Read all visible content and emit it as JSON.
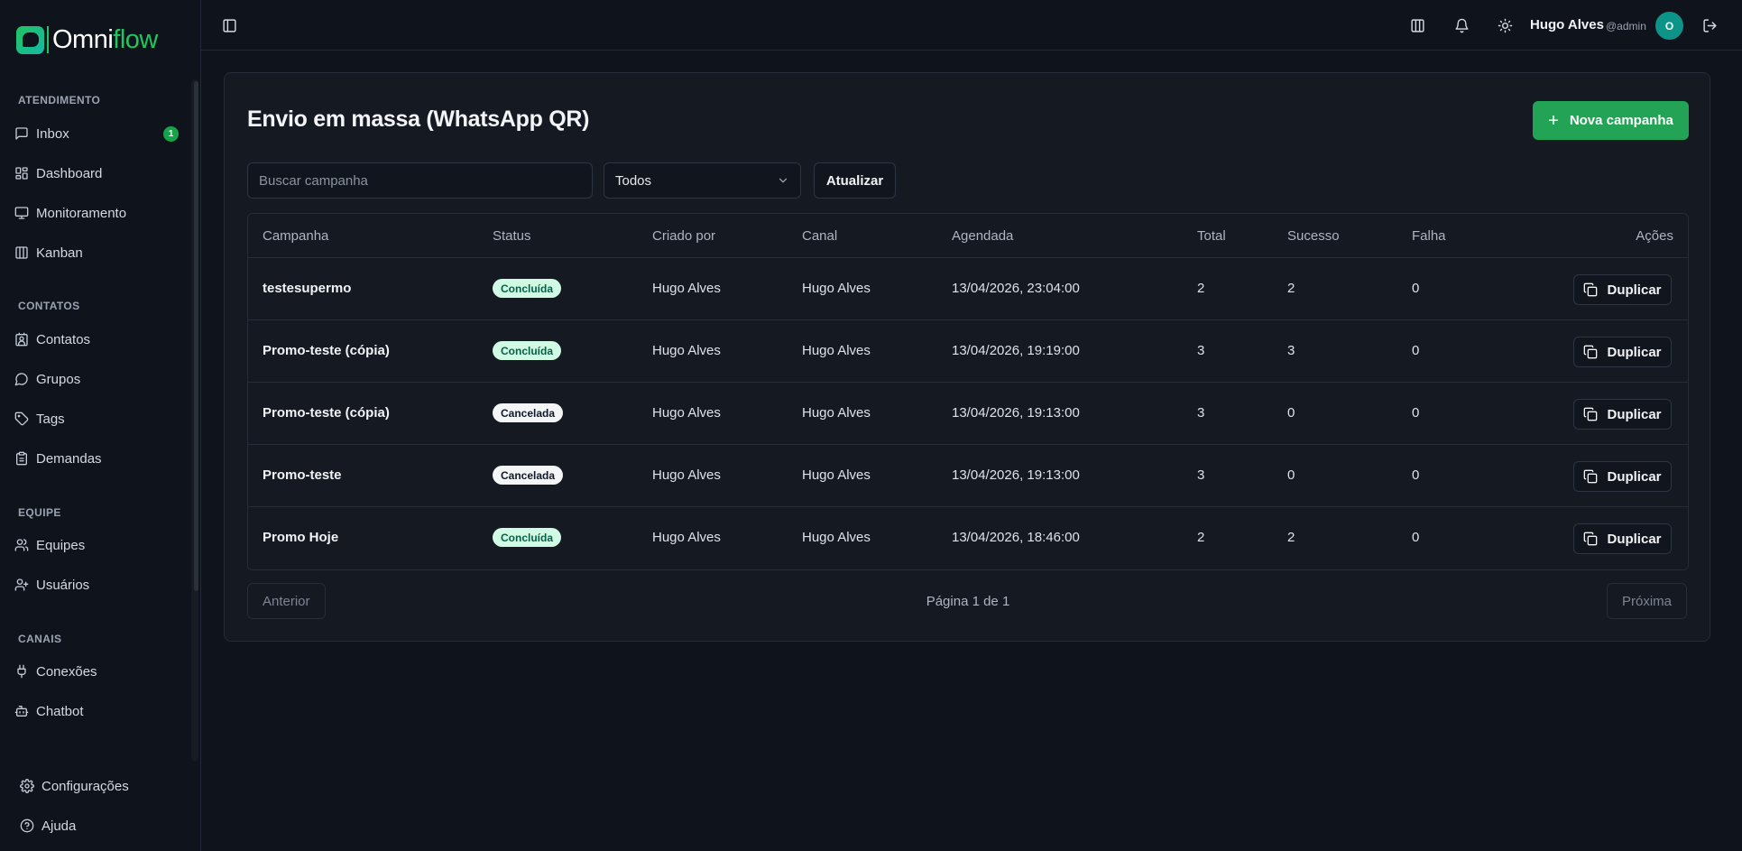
{
  "brand": {
    "name_part1": "Omni",
    "name_part2": "flow"
  },
  "sidebar": {
    "sections": [
      {
        "title": "ATENDIMENTO",
        "items": [
          {
            "label": "Inbox",
            "icon": "message-square-icon",
            "badge": "1"
          },
          {
            "label": "Dashboard",
            "icon": "layout-dashboard-icon"
          },
          {
            "label": "Monitoramento",
            "icon": "monitor-icon"
          },
          {
            "label": "Kanban",
            "icon": "kanban-icon"
          }
        ]
      },
      {
        "title": "CONTATOS",
        "items": [
          {
            "label": "Contatos",
            "icon": "contact-icon"
          },
          {
            "label": "Grupos",
            "icon": "message-circle-icon"
          },
          {
            "label": "Tags",
            "icon": "tag-icon"
          },
          {
            "label": "Demandas",
            "icon": "clipboard-icon"
          }
        ]
      },
      {
        "title": "EQUIPE",
        "items": [
          {
            "label": "Equipes",
            "icon": "users-icon"
          },
          {
            "label": "Usuários",
            "icon": "user-icon"
          }
        ]
      },
      {
        "title": "CANAIS",
        "items": [
          {
            "label": "Conexões",
            "icon": "plug-icon"
          },
          {
            "label": "Chatbot",
            "icon": "bot-icon"
          }
        ]
      }
    ],
    "footer": [
      {
        "label": "Configurações",
        "icon": "settings-icon"
      },
      {
        "label": "Ajuda",
        "icon": "help-circle-icon"
      }
    ]
  },
  "header": {
    "user_name": "Hugo Alves",
    "user_handle": "@admin",
    "avatar_initial": "O"
  },
  "page": {
    "title": "Envio em massa (WhatsApp QR)",
    "new_button": "Nova campanha",
    "search_placeholder": "Buscar campanha",
    "filter_value": "Todos",
    "refresh_button": "Atualizar"
  },
  "table": {
    "columns": [
      "Campanha",
      "Status",
      "Criado por",
      "Canal",
      "Agendada",
      "Total",
      "Sucesso",
      "Falha",
      "Ações"
    ],
    "action_label": "Duplicar",
    "rows": [
      {
        "name": "testesupermo",
        "status": "Concluída",
        "status_kind": "ok",
        "created_by": "Hugo Alves",
        "channel": "Hugo Alves",
        "scheduled": "13/04/2026, 23:04:00",
        "total": "2",
        "success": "2",
        "fail": "0"
      },
      {
        "name": "Promo-teste (cópia)",
        "status": "Concluída",
        "status_kind": "ok",
        "created_by": "Hugo Alves",
        "channel": "Hugo Alves",
        "scheduled": "13/04/2026, 19:19:00",
        "total": "3",
        "success": "3",
        "fail": "0"
      },
      {
        "name": "Promo-teste (cópia)",
        "status": "Cancelada",
        "status_kind": "cancel",
        "created_by": "Hugo Alves",
        "channel": "Hugo Alves",
        "scheduled": "13/04/2026, 19:13:00",
        "total": "3",
        "success": "0",
        "fail": "0"
      },
      {
        "name": "Promo-teste",
        "status": "Cancelada",
        "status_kind": "cancel",
        "created_by": "Hugo Alves",
        "channel": "Hugo Alves",
        "scheduled": "13/04/2026, 19:13:00",
        "total": "3",
        "success": "0",
        "fail": "0"
      },
      {
        "name": "Promo Hoje",
        "status": "Concluída",
        "status_kind": "ok",
        "created_by": "Hugo Alves",
        "channel": "Hugo Alves",
        "scheduled": "13/04/2026, 18:46:00",
        "total": "2",
        "success": "2",
        "fail": "0"
      }
    ]
  },
  "pagination": {
    "prev": "Anterior",
    "info": "Página 1 de 1",
    "next": "Próxima"
  },
  "colors": {
    "accent": "#22a355",
    "badge_ok_bg": "#d1fae5",
    "badge_ok_text": "#065f46",
    "background": "#0f131b"
  }
}
